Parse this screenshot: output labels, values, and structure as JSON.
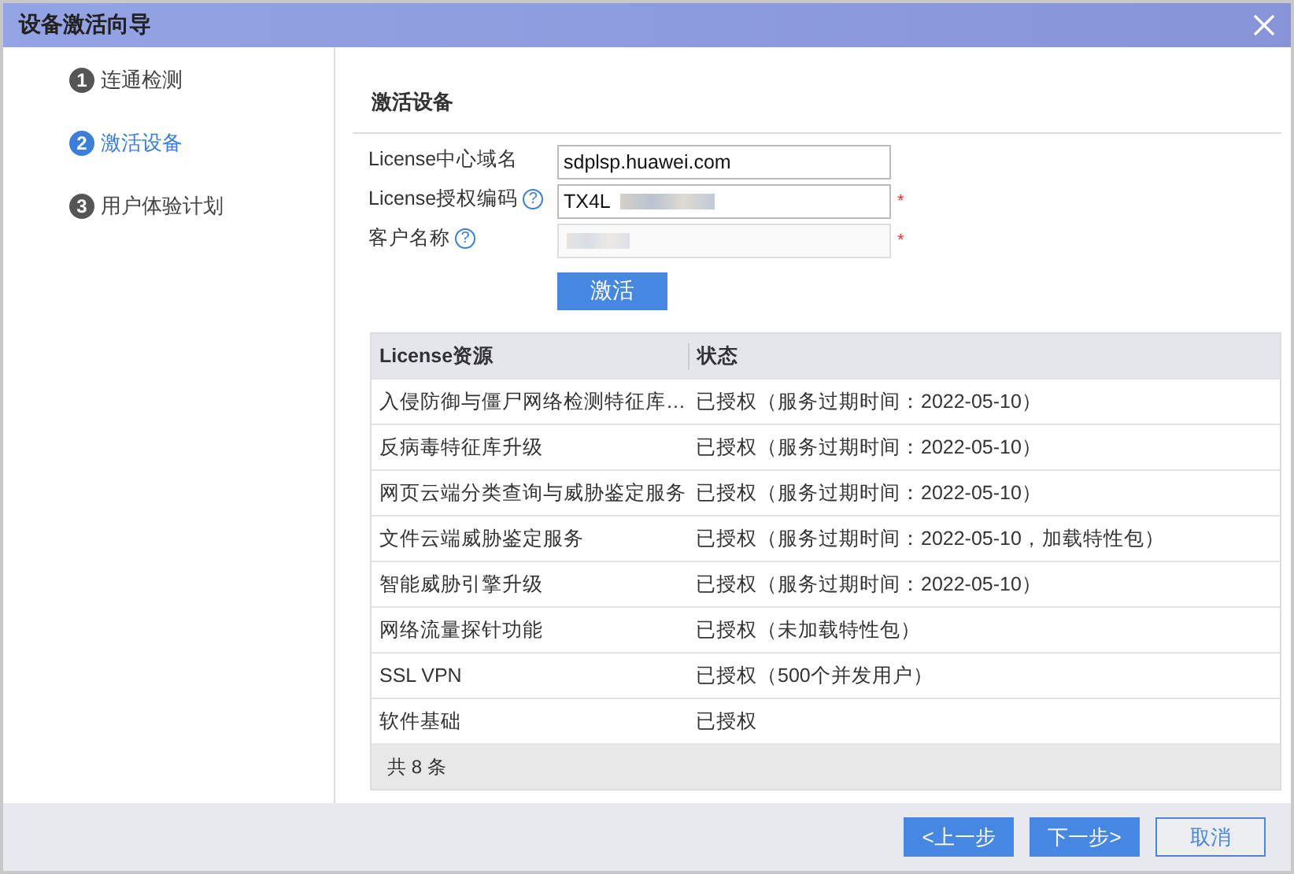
{
  "window": {
    "title": "设备激活向导"
  },
  "steps": [
    {
      "number": "1",
      "label": "连通检测",
      "selected": false
    },
    {
      "number": "2",
      "label": "激活设备",
      "selected": true
    },
    {
      "number": "3",
      "label": "用户体验计划",
      "selected": false
    }
  ],
  "section_title": "激活设备",
  "form": [
    {
      "label": "License中心域名",
      "value": "sdplsp.huawei.com",
      "disabled": false,
      "redacted": false
    },
    {
      "label": "License授权编码",
      "value": "TX4L",
      "help": "?",
      "required": "*",
      "disabled": false,
      "redacted": true
    },
    {
      "label": "客户名称",
      "help": "?",
      "required": "*",
      "disabled": true,
      "redacted": true
    }
  ],
  "activate_button": "激活",
  "table": {
    "columns": [
      "License资源",
      "状态"
    ],
    "rows": [
      [
        "入侵防御与僵尸网络检测特征库…",
        "已授权（服务过期时间：2022-05-10）"
      ],
      [
        "反病毒特征库升级",
        "已授权（服务过期时间：2022-05-10）"
      ],
      [
        "网页云端分类查询与威胁鉴定服务",
        "已授权（服务过期时间：2022-05-10）"
      ],
      [
        "文件云端威胁鉴定服务",
        "已授权（服务过期时间：2022-05-10，加载特性包）"
      ],
      [
        "智能威胁引擎升级",
        "已授权（服务过期时间：2022-05-10）"
      ],
      [
        "网络流量探针功能",
        "已授权（未加载特性包）"
      ],
      [
        "SSL VPN",
        "已授权（500个并发用户）"
      ],
      [
        "软件基础",
        "已授权"
      ]
    ],
    "footer": "共 8 条"
  },
  "buttons": [
    {
      "label": "<上一步",
      "kind": "primary"
    },
    {
      "label": "下一步>",
      "kind": "primary"
    },
    {
      "label": "取消",
      "kind": "secondary"
    }
  ]
}
